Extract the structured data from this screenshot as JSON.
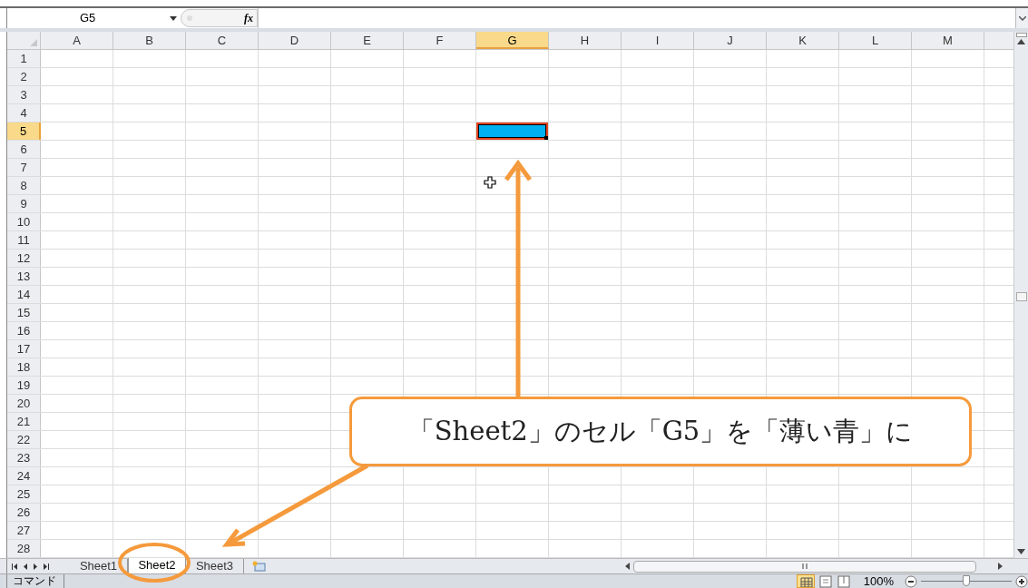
{
  "formula_bar": {
    "name_box": "G5",
    "function_label": "fx"
  },
  "columns": [
    {
      "label": "A",
      "selected": false
    },
    {
      "label": "B",
      "selected": false
    },
    {
      "label": "C",
      "selected": false
    },
    {
      "label": "D",
      "selected": false
    },
    {
      "label": "E",
      "selected": false
    },
    {
      "label": "F",
      "selected": false
    },
    {
      "label": "G",
      "selected": true
    },
    {
      "label": "H",
      "selected": false
    },
    {
      "label": "I",
      "selected": false
    },
    {
      "label": "J",
      "selected": false
    },
    {
      "label": "K",
      "selected": false
    },
    {
      "label": "L",
      "selected": false
    },
    {
      "label": "M",
      "selected": false
    }
  ],
  "rows": [
    {
      "label": "1",
      "selected": false
    },
    {
      "label": "2",
      "selected": false
    },
    {
      "label": "3",
      "selected": false
    },
    {
      "label": "4",
      "selected": false
    },
    {
      "label": "5",
      "selected": true
    },
    {
      "label": "6",
      "selected": false
    },
    {
      "label": "7",
      "selected": false
    },
    {
      "label": "8",
      "selected": false
    },
    {
      "label": "9",
      "selected": false
    },
    {
      "label": "10",
      "selected": false
    },
    {
      "label": "11",
      "selected": false
    },
    {
      "label": "12",
      "selected": false
    },
    {
      "label": "13",
      "selected": false
    },
    {
      "label": "14",
      "selected": false
    },
    {
      "label": "15",
      "selected": false
    },
    {
      "label": "16",
      "selected": false
    },
    {
      "label": "17",
      "selected": false
    },
    {
      "label": "18",
      "selected": false
    },
    {
      "label": "19",
      "selected": false
    },
    {
      "label": "20",
      "selected": false
    },
    {
      "label": "21",
      "selected": false
    },
    {
      "label": "22",
      "selected": false
    },
    {
      "label": "23",
      "selected": false
    },
    {
      "label": "24",
      "selected": false
    },
    {
      "label": "25",
      "selected": false
    },
    {
      "label": "26",
      "selected": false
    },
    {
      "label": "27",
      "selected": false
    },
    {
      "label": "28",
      "selected": false
    }
  ],
  "sheet_tabs": [
    {
      "label": "Sheet1",
      "selected": false
    },
    {
      "label": "Sheet2",
      "selected": true
    },
    {
      "label": "Sheet3",
      "selected": false
    }
  ],
  "status_bar": {
    "mode": "コマンド",
    "zoom": "100%",
    "zoom_slider": {
      "level": 0.5
    }
  },
  "callout": {
    "text": "「Sheet2」のセル「G5」を「薄い青」に"
  }
}
